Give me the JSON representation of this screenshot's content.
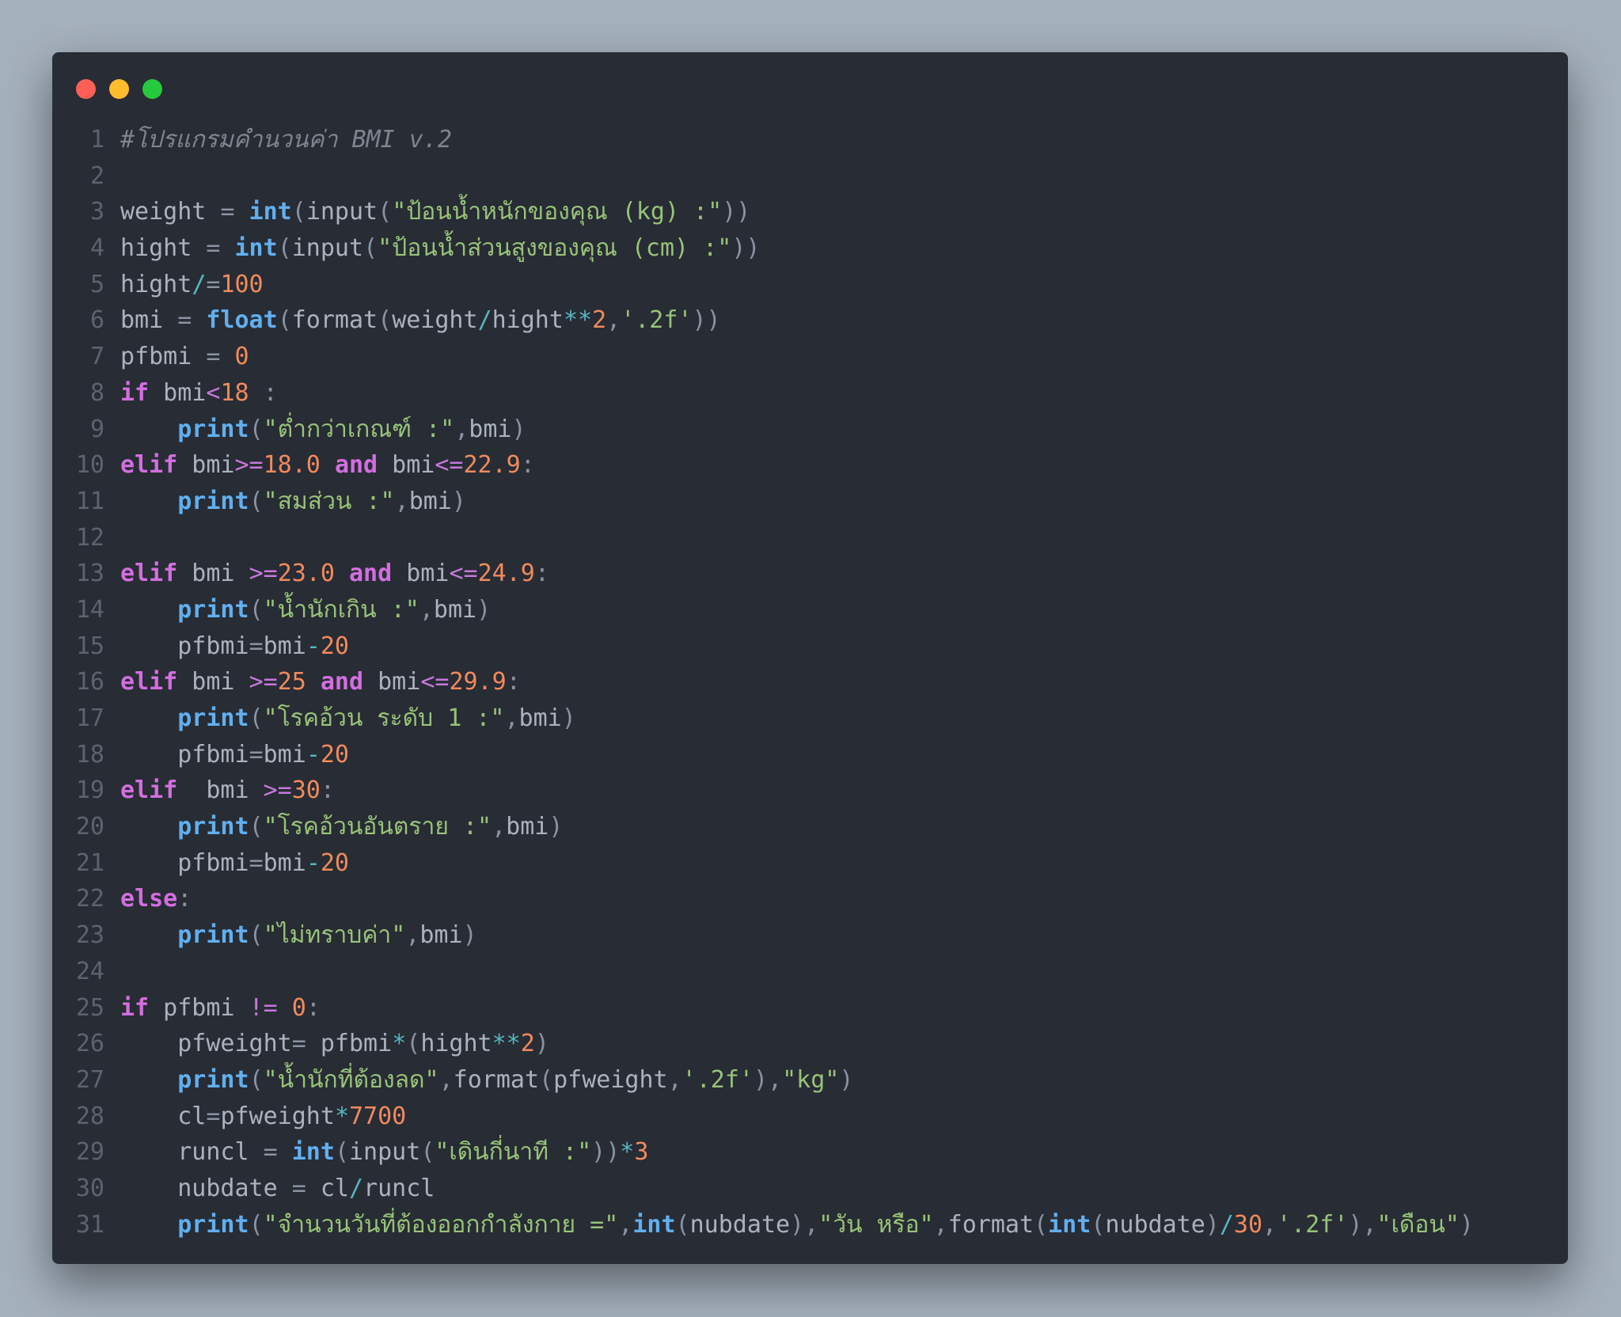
{
  "window": {
    "traffic_lights": [
      "close",
      "minimize",
      "maximize"
    ],
    "colors": {
      "close": "#ff5f56",
      "minimize": "#ffbd2e",
      "maximize": "#27c93f"
    }
  },
  "editor": {
    "language": "python",
    "lines": [
      {
        "n": "1",
        "tokens": [
          [
            "comment",
            "#โปรแกรมคำนวนค่า BMI v.2"
          ]
        ]
      },
      {
        "n": "2",
        "tokens": []
      },
      {
        "n": "3",
        "tokens": [
          [
            "text",
            "weight "
          ],
          [
            "punct",
            "="
          ],
          [
            "text",
            " "
          ],
          [
            "builtin",
            "int"
          ],
          [
            "punct",
            "("
          ],
          [
            "text",
            "input"
          ],
          [
            "punct",
            "("
          ],
          [
            "string",
            "\"ป้อนน้ำหนักของคุณ (kg) :\""
          ],
          [
            "punct",
            "))"
          ]
        ]
      },
      {
        "n": "4",
        "tokens": [
          [
            "text",
            "hight "
          ],
          [
            "punct",
            "="
          ],
          [
            "text",
            " "
          ],
          [
            "builtin",
            "int"
          ],
          [
            "punct",
            "("
          ],
          [
            "text",
            "input"
          ],
          [
            "punct",
            "("
          ],
          [
            "string",
            "\"ป้อนน้ำส่วนสูงของคุณ (cm) :\""
          ],
          [
            "punct",
            "))"
          ]
        ]
      },
      {
        "n": "5",
        "tokens": [
          [
            "text",
            "hight"
          ],
          [
            "aop",
            "/"
          ],
          [
            "punct",
            "="
          ],
          [
            "number",
            "100"
          ]
        ]
      },
      {
        "n": "6",
        "tokens": [
          [
            "text",
            "bmi "
          ],
          [
            "punct",
            "="
          ],
          [
            "text",
            " "
          ],
          [
            "builtin",
            "float"
          ],
          [
            "punct",
            "("
          ],
          [
            "text",
            "format"
          ],
          [
            "punct",
            "("
          ],
          [
            "text",
            "weight"
          ],
          [
            "aop",
            "/"
          ],
          [
            "text",
            "hight"
          ],
          [
            "aop",
            "**"
          ],
          [
            "number",
            "2"
          ],
          [
            "punct",
            ","
          ],
          [
            "string",
            "'.2f'"
          ],
          [
            "punct",
            "))"
          ]
        ]
      },
      {
        "n": "7",
        "tokens": [
          [
            "text",
            "pfbmi "
          ],
          [
            "punct",
            "="
          ],
          [
            "text",
            " "
          ],
          [
            "number",
            "0"
          ]
        ]
      },
      {
        "n": "8",
        "tokens": [
          [
            "keyword",
            "if"
          ],
          [
            "text",
            " bmi"
          ],
          [
            "operator",
            "<"
          ],
          [
            "number",
            "18"
          ],
          [
            "text",
            " "
          ],
          [
            "punct",
            ":"
          ]
        ]
      },
      {
        "n": "9",
        "tokens": [
          [
            "text",
            "    "
          ],
          [
            "builtin",
            "print"
          ],
          [
            "punct",
            "("
          ],
          [
            "string",
            "\"ต่ำกว่าเกณฑ์ :\""
          ],
          [
            "punct",
            ","
          ],
          [
            "text",
            "bmi"
          ],
          [
            "punct",
            ")"
          ]
        ]
      },
      {
        "n": "10",
        "tokens": [
          [
            "keyword",
            "elif"
          ],
          [
            "text",
            " bmi"
          ],
          [
            "operator",
            ">="
          ],
          [
            "number",
            "18.0"
          ],
          [
            "text",
            " "
          ],
          [
            "keyword",
            "and"
          ],
          [
            "text",
            " bmi"
          ],
          [
            "operator",
            "<="
          ],
          [
            "number",
            "22.9"
          ],
          [
            "punct",
            ":"
          ]
        ]
      },
      {
        "n": "11",
        "tokens": [
          [
            "text",
            "    "
          ],
          [
            "builtin",
            "print"
          ],
          [
            "punct",
            "("
          ],
          [
            "string",
            "\"สมส่วน :\""
          ],
          [
            "punct",
            ","
          ],
          [
            "text",
            "bmi"
          ],
          [
            "punct",
            ")"
          ]
        ]
      },
      {
        "n": "12",
        "tokens": []
      },
      {
        "n": "13",
        "tokens": [
          [
            "keyword",
            "elif"
          ],
          [
            "text",
            " bmi "
          ],
          [
            "operator",
            ">="
          ],
          [
            "number",
            "23.0"
          ],
          [
            "text",
            " "
          ],
          [
            "keyword",
            "and"
          ],
          [
            "text",
            " bmi"
          ],
          [
            "operator",
            "<="
          ],
          [
            "number",
            "24.9"
          ],
          [
            "punct",
            ":"
          ]
        ]
      },
      {
        "n": "14",
        "tokens": [
          [
            "text",
            "    "
          ],
          [
            "builtin",
            "print"
          ],
          [
            "punct",
            "("
          ],
          [
            "string",
            "\"น้ำนักเกิน :\""
          ],
          [
            "punct",
            ","
          ],
          [
            "text",
            "bmi"
          ],
          [
            "punct",
            ")"
          ]
        ]
      },
      {
        "n": "15",
        "tokens": [
          [
            "text",
            "    pfbmi"
          ],
          [
            "punct",
            "="
          ],
          [
            "text",
            "bmi"
          ],
          [
            "aop",
            "-"
          ],
          [
            "number",
            "20"
          ]
        ]
      },
      {
        "n": "16",
        "tokens": [
          [
            "keyword",
            "elif"
          ],
          [
            "text",
            " bmi "
          ],
          [
            "operator",
            ">="
          ],
          [
            "number",
            "25"
          ],
          [
            "text",
            " "
          ],
          [
            "keyword",
            "and"
          ],
          [
            "text",
            " bmi"
          ],
          [
            "operator",
            "<="
          ],
          [
            "number",
            "29.9"
          ],
          [
            "punct",
            ":"
          ]
        ]
      },
      {
        "n": "17",
        "tokens": [
          [
            "text",
            "    "
          ],
          [
            "builtin",
            "print"
          ],
          [
            "punct",
            "("
          ],
          [
            "string",
            "\"โรคอ้วน ระดับ 1 :\""
          ],
          [
            "punct",
            ","
          ],
          [
            "text",
            "bmi"
          ],
          [
            "punct",
            ")"
          ]
        ]
      },
      {
        "n": "18",
        "tokens": [
          [
            "text",
            "    pfbmi"
          ],
          [
            "punct",
            "="
          ],
          [
            "text",
            "bmi"
          ],
          [
            "aop",
            "-"
          ],
          [
            "number",
            "20"
          ]
        ]
      },
      {
        "n": "19",
        "tokens": [
          [
            "keyword",
            "elif"
          ],
          [
            "text",
            "  bmi "
          ],
          [
            "operator",
            ">="
          ],
          [
            "number",
            "30"
          ],
          [
            "punct",
            ":"
          ]
        ]
      },
      {
        "n": "20",
        "tokens": [
          [
            "text",
            "    "
          ],
          [
            "builtin",
            "print"
          ],
          [
            "punct",
            "("
          ],
          [
            "string",
            "\"โรคอ้วนอันตราย :\""
          ],
          [
            "punct",
            ","
          ],
          [
            "text",
            "bmi"
          ],
          [
            "punct",
            ")"
          ]
        ]
      },
      {
        "n": "21",
        "tokens": [
          [
            "text",
            "    pfbmi"
          ],
          [
            "punct",
            "="
          ],
          [
            "text",
            "bmi"
          ],
          [
            "aop",
            "-"
          ],
          [
            "number",
            "20"
          ]
        ]
      },
      {
        "n": "22",
        "tokens": [
          [
            "keyword",
            "else"
          ],
          [
            "punct",
            ":"
          ]
        ]
      },
      {
        "n": "23",
        "tokens": [
          [
            "text",
            "    "
          ],
          [
            "builtin",
            "print"
          ],
          [
            "punct",
            "("
          ],
          [
            "string",
            "\"ไม่ทราบค่า\""
          ],
          [
            "punct",
            ","
          ],
          [
            "text",
            "bmi"
          ],
          [
            "punct",
            ")"
          ]
        ]
      },
      {
        "n": "24",
        "tokens": []
      },
      {
        "n": "25",
        "tokens": [
          [
            "keyword",
            "if"
          ],
          [
            "text",
            " pfbmi "
          ],
          [
            "operator",
            "!="
          ],
          [
            "text",
            " "
          ],
          [
            "number",
            "0"
          ],
          [
            "punct",
            ":"
          ]
        ]
      },
      {
        "n": "26",
        "tokens": [
          [
            "text",
            "    pfweight"
          ],
          [
            "punct",
            "="
          ],
          [
            "text",
            " pfbmi"
          ],
          [
            "aop",
            "*"
          ],
          [
            "punct",
            "("
          ],
          [
            "text",
            "hight"
          ],
          [
            "aop",
            "**"
          ],
          [
            "number",
            "2"
          ],
          [
            "punct",
            ")"
          ]
        ]
      },
      {
        "n": "27",
        "tokens": [
          [
            "text",
            "    "
          ],
          [
            "builtin",
            "print"
          ],
          [
            "punct",
            "("
          ],
          [
            "string",
            "\"น้ำนักที่ต้องลด\""
          ],
          [
            "punct",
            ","
          ],
          [
            "text",
            "format"
          ],
          [
            "punct",
            "("
          ],
          [
            "text",
            "pfweight"
          ],
          [
            "punct",
            ","
          ],
          [
            "string",
            "'.2f'"
          ],
          [
            "punct",
            "),"
          ],
          [
            "string",
            "\"kg\""
          ],
          [
            "punct",
            ")"
          ]
        ]
      },
      {
        "n": "28",
        "tokens": [
          [
            "text",
            "    cl"
          ],
          [
            "punct",
            "="
          ],
          [
            "text",
            "pfweight"
          ],
          [
            "aop",
            "*"
          ],
          [
            "number",
            "7700"
          ]
        ]
      },
      {
        "n": "29",
        "tokens": [
          [
            "text",
            "    runcl "
          ],
          [
            "punct",
            "="
          ],
          [
            "text",
            " "
          ],
          [
            "builtin",
            "int"
          ],
          [
            "punct",
            "("
          ],
          [
            "text",
            "input"
          ],
          [
            "punct",
            "("
          ],
          [
            "string",
            "\"เดินกี่นาที :\""
          ],
          [
            "punct",
            "))"
          ],
          [
            "aop",
            "*"
          ],
          [
            "number",
            "3"
          ]
        ]
      },
      {
        "n": "30",
        "tokens": [
          [
            "text",
            "    nubdate "
          ],
          [
            "punct",
            "="
          ],
          [
            "text",
            " cl"
          ],
          [
            "aop",
            "/"
          ],
          [
            "text",
            "runcl"
          ]
        ]
      },
      {
        "n": "31",
        "tokens": [
          [
            "text",
            "    "
          ],
          [
            "builtin",
            "print"
          ],
          [
            "punct",
            "("
          ],
          [
            "string",
            "\"จำนวนวันที่ต้องออกกำลังกาย =\""
          ],
          [
            "punct",
            ","
          ],
          [
            "builtin",
            "int"
          ],
          [
            "punct",
            "("
          ],
          [
            "text",
            "nubdate"
          ],
          [
            "punct",
            "),"
          ],
          [
            "string",
            "\"วัน หรือ\""
          ],
          [
            "punct",
            ","
          ],
          [
            "text",
            "format"
          ],
          [
            "punct",
            "("
          ],
          [
            "builtin",
            "int"
          ],
          [
            "punct",
            "("
          ],
          [
            "text",
            "nubdate"
          ],
          [
            "punct",
            ")"
          ],
          [
            "aop",
            "/"
          ],
          [
            "number",
            "30"
          ],
          [
            "punct",
            ","
          ],
          [
            "string",
            "'.2f'"
          ],
          [
            "punct",
            "),"
          ],
          [
            "string",
            "\"เดือน\""
          ],
          [
            "punct",
            ")"
          ]
        ]
      }
    ]
  }
}
